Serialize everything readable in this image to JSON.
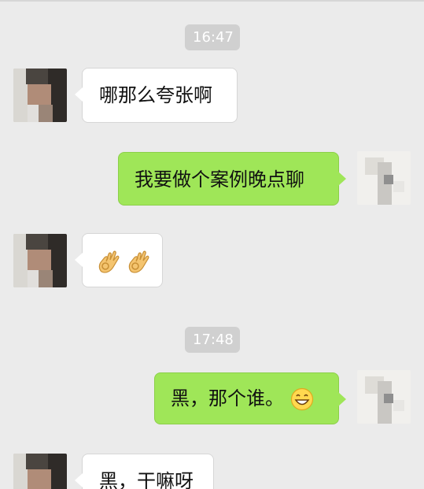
{
  "conversation": {
    "timestamps": [
      "16:47",
      "17:48"
    ],
    "messages": [
      {
        "sender": "contact",
        "text": "哪那么夸张啊"
      },
      {
        "sender": "me",
        "text": "我要做个案例晚点聊"
      },
      {
        "sender": "contact",
        "text": "",
        "emojis": [
          "ok-hand-emoji",
          "ok-hand-emoji"
        ]
      },
      {
        "sender": "me",
        "text": "黑，那个谁。",
        "emojis": [
          "grinning-face-emoji"
        ]
      },
      {
        "sender": "contact",
        "text": "黑，干嘛呀"
      }
    ]
  },
  "colors": {
    "background": "#ebebeb",
    "incoming_bubble": "#ffffff",
    "outgoing_bubble": "#9fe658",
    "timestamp_pill": "#d0d0d0"
  }
}
